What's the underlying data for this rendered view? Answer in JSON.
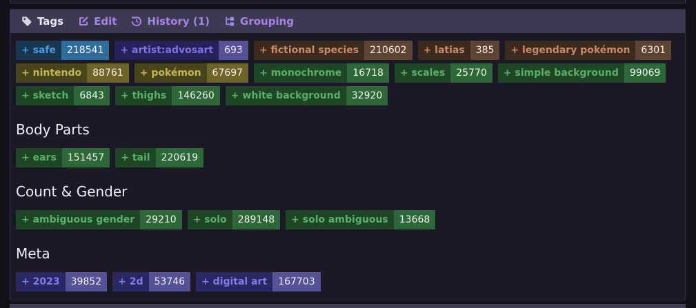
{
  "panel": {
    "plus_prefix": "+",
    "header": {
      "items": [
        {
          "label": "Tags"
        },
        {
          "label": "Edit"
        },
        {
          "label": "History (1)"
        },
        {
          "label": "Grouping"
        }
      ]
    },
    "sections": [
      {
        "heading": "",
        "tags": [
          {
            "label": "safe",
            "count": "218541",
            "category": "rating"
          },
          {
            "label": "artist:advosart",
            "count": "693",
            "category": "artist"
          },
          {
            "label": "fictional species",
            "count": "210602",
            "category": "species"
          },
          {
            "label": "latias",
            "count": "385",
            "category": "species"
          },
          {
            "label": "legendary pokémon",
            "count": "6301",
            "category": "species"
          },
          {
            "label": "nintendo",
            "count": "88761",
            "category": "copyright"
          },
          {
            "label": "pokémon",
            "count": "67697",
            "category": "copyright"
          },
          {
            "label": "monochrome",
            "count": "16718",
            "category": "general"
          },
          {
            "label": "scales",
            "count": "25770",
            "category": "general"
          },
          {
            "label": "simple background",
            "count": "99069",
            "category": "general"
          },
          {
            "label": "sketch",
            "count": "6843",
            "category": "general"
          },
          {
            "label": "thighs",
            "count": "146260",
            "category": "general"
          },
          {
            "label": "white background",
            "count": "32920",
            "category": "general"
          }
        ]
      },
      {
        "heading": "Body Parts",
        "tags": [
          {
            "label": "ears",
            "count": "151457",
            "category": "general"
          },
          {
            "label": "tail",
            "count": "220619",
            "category": "general"
          }
        ]
      },
      {
        "heading": "Count & Gender",
        "tags": [
          {
            "label": "ambiguous gender",
            "count": "29210",
            "category": "general"
          },
          {
            "label": "solo",
            "count": "289148",
            "category": "general"
          },
          {
            "label": "solo ambiguous",
            "count": "13668",
            "category": "general"
          }
        ]
      },
      {
        "heading": "Meta",
        "tags": [
          {
            "label": "2023",
            "count": "39852",
            "category": "meta"
          },
          {
            "label": "2d",
            "count": "53746",
            "category": "meta"
          },
          {
            "label": "digital art",
            "count": "167703",
            "category": "meta"
          }
        ]
      }
    ]
  },
  "colors": {
    "page_bg": "#131019",
    "panel_bg": "#1c1926",
    "panel_border": "#332e4a",
    "header_bg": "#3e3952",
    "header_link": "#a285e4",
    "header_current": "#e9e6f2",
    "heading_text": "#f1eff5",
    "categories": {
      "rating": {
        "label_bg": "#17364f",
        "label_fg": "#4f9be0",
        "count_bg": "#2e6c9e",
        "count_fg": "#f0f6fc"
      },
      "artist": {
        "label_bg": "#262158",
        "label_fg": "#7b74e4",
        "count_bg": "#575198",
        "count_fg": "#efedf8"
      },
      "species": {
        "label_bg": "#3c2a1e",
        "label_fg": "#c98a68",
        "count_bg": "#5e4533",
        "count_fg": "#f4ede7"
      },
      "copyright": {
        "label_bg": "#48431a",
        "label_fg": "#c3b94e",
        "count_bg": "#6c6428",
        "count_fg": "#f6f4e4"
      },
      "general": {
        "label_bg": "#1d4526",
        "label_fg": "#57b066",
        "count_bg": "#2e6839",
        "count_fg": "#eef6ef"
      },
      "meta": {
        "label_bg": "#2a2863",
        "label_fg": "#817be8",
        "count_bg": "#565298",
        "count_fg": "#efeef8"
      }
    }
  }
}
